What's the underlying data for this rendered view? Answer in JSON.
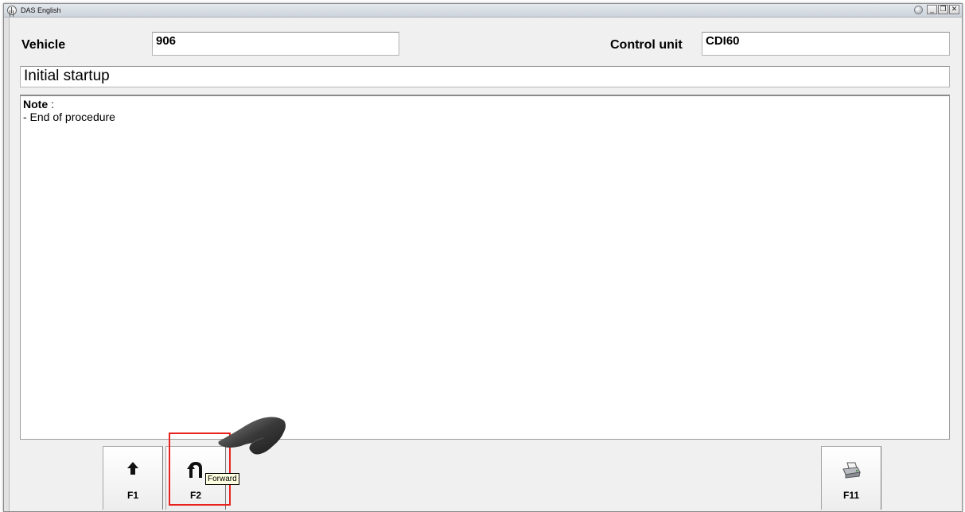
{
  "window": {
    "title": "DAS English",
    "controls": {
      "minimize": "_",
      "restore": "❐",
      "close": "✕"
    }
  },
  "header": {
    "vehicle_label": "Vehicle",
    "vehicle_value": "906",
    "control_unit_label": "Control unit",
    "control_unit_value": "CDI60"
  },
  "procedure_title": "Initial startup",
  "note": {
    "title": "Note",
    "separator": " :",
    "lines": [
      "- End of procedure"
    ]
  },
  "function_keys": [
    {
      "label": "F1",
      "icon": "up-arrow-icon"
    },
    {
      "label": "F2",
      "icon": "forward-icon"
    },
    {
      "label": "F11",
      "icon": "printer-icon"
    }
  ],
  "tooltip": "Forward",
  "colors": {
    "highlight": "#e8231f",
    "titlebar": "#cdd3db",
    "tooltip_bg": "#ffffe1"
  }
}
